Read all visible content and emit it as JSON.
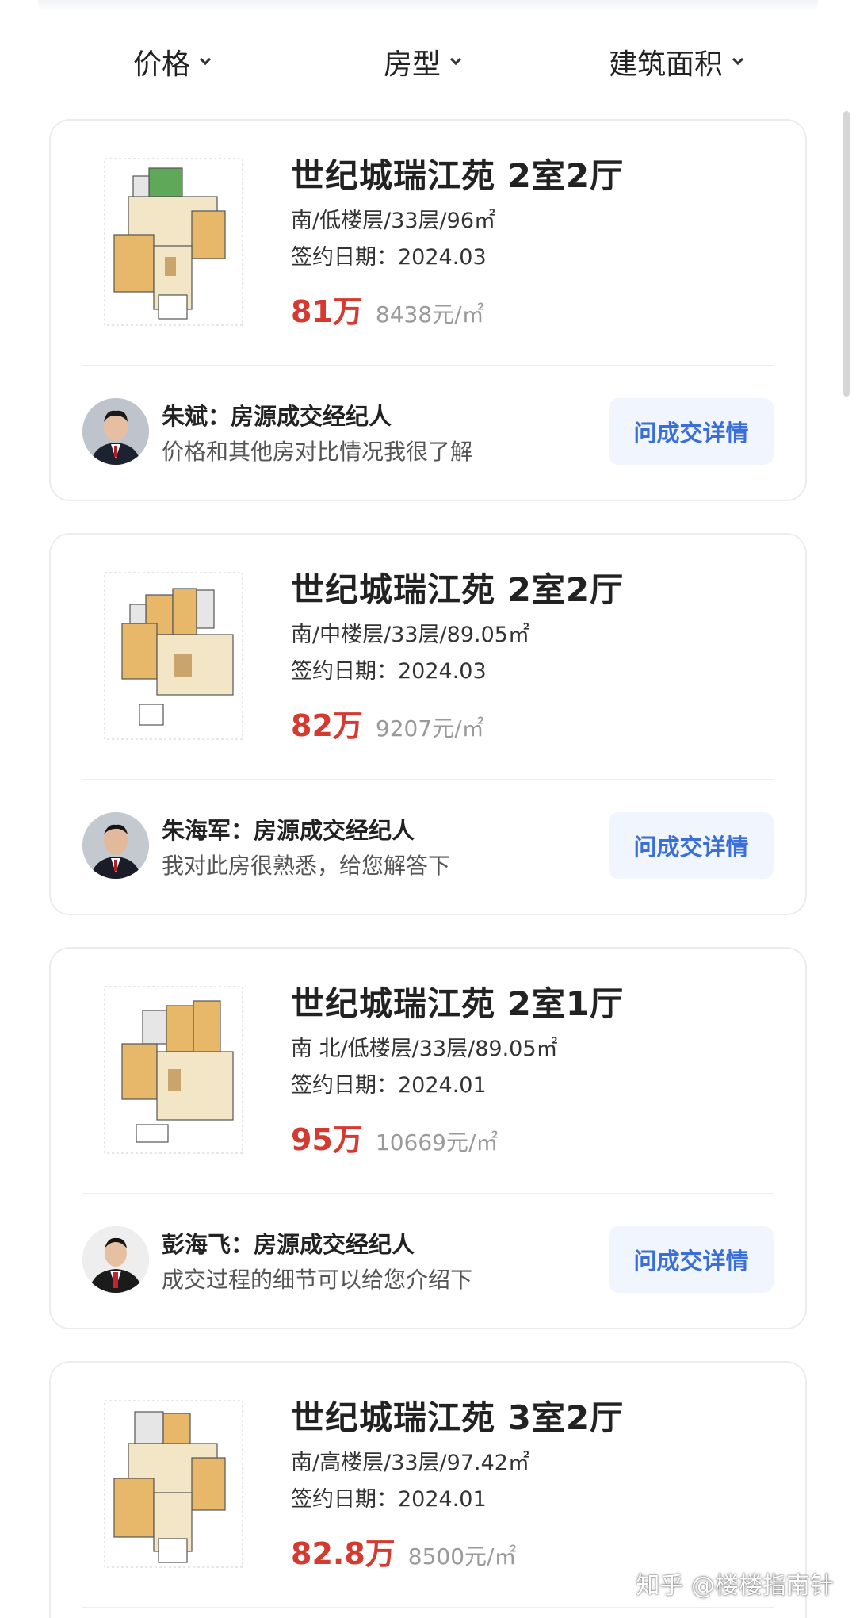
{
  "filters": [
    {
      "label": "价格"
    },
    {
      "label": "房型"
    },
    {
      "label": "建筑面积"
    }
  ],
  "listings": [
    {
      "title": "世纪城瑞江苑 2室2厅",
      "meta": "南/低楼层/33层/96㎡",
      "date": "签约日期：2024.03",
      "price": "81万",
      "unit_price": "8438元/㎡",
      "agent_name": "朱斌：房源成交经纪人",
      "agent_desc": "价格和其他房对比情况我很了解",
      "button": "问成交详情"
    },
    {
      "title": "世纪城瑞江苑 2室2厅",
      "meta": "南/中楼层/33层/89.05㎡",
      "date": "签约日期：2024.03",
      "price": "82万",
      "unit_price": "9207元/㎡",
      "agent_name": "朱海军：房源成交经纪人",
      "agent_desc": "我对此房很熟悉，给您解答下",
      "button": "问成交详情"
    },
    {
      "title": "世纪城瑞江苑 2室1厅",
      "meta": "南 北/低楼层/33层/89.05㎡",
      "date": "签约日期：2024.01",
      "price": "95万",
      "unit_price": "10669元/㎡",
      "agent_name": "彭海飞：房源成交经纪人",
      "agent_desc": "成交过程的细节可以给您介绍下",
      "button": "问成交详情"
    },
    {
      "title": "世纪城瑞江苑 3室2厅",
      "meta": "南/高楼层/33层/97.42㎡",
      "date": "签约日期：2024.01",
      "price": "82.8万",
      "unit_price": "8500元/㎡"
    }
  ],
  "watermark": "知乎 @楼楼指南针",
  "colors": {
    "price": "#d43a2f",
    "button_text": "#3a6fd8",
    "button_bg": "#f1f5fd"
  }
}
